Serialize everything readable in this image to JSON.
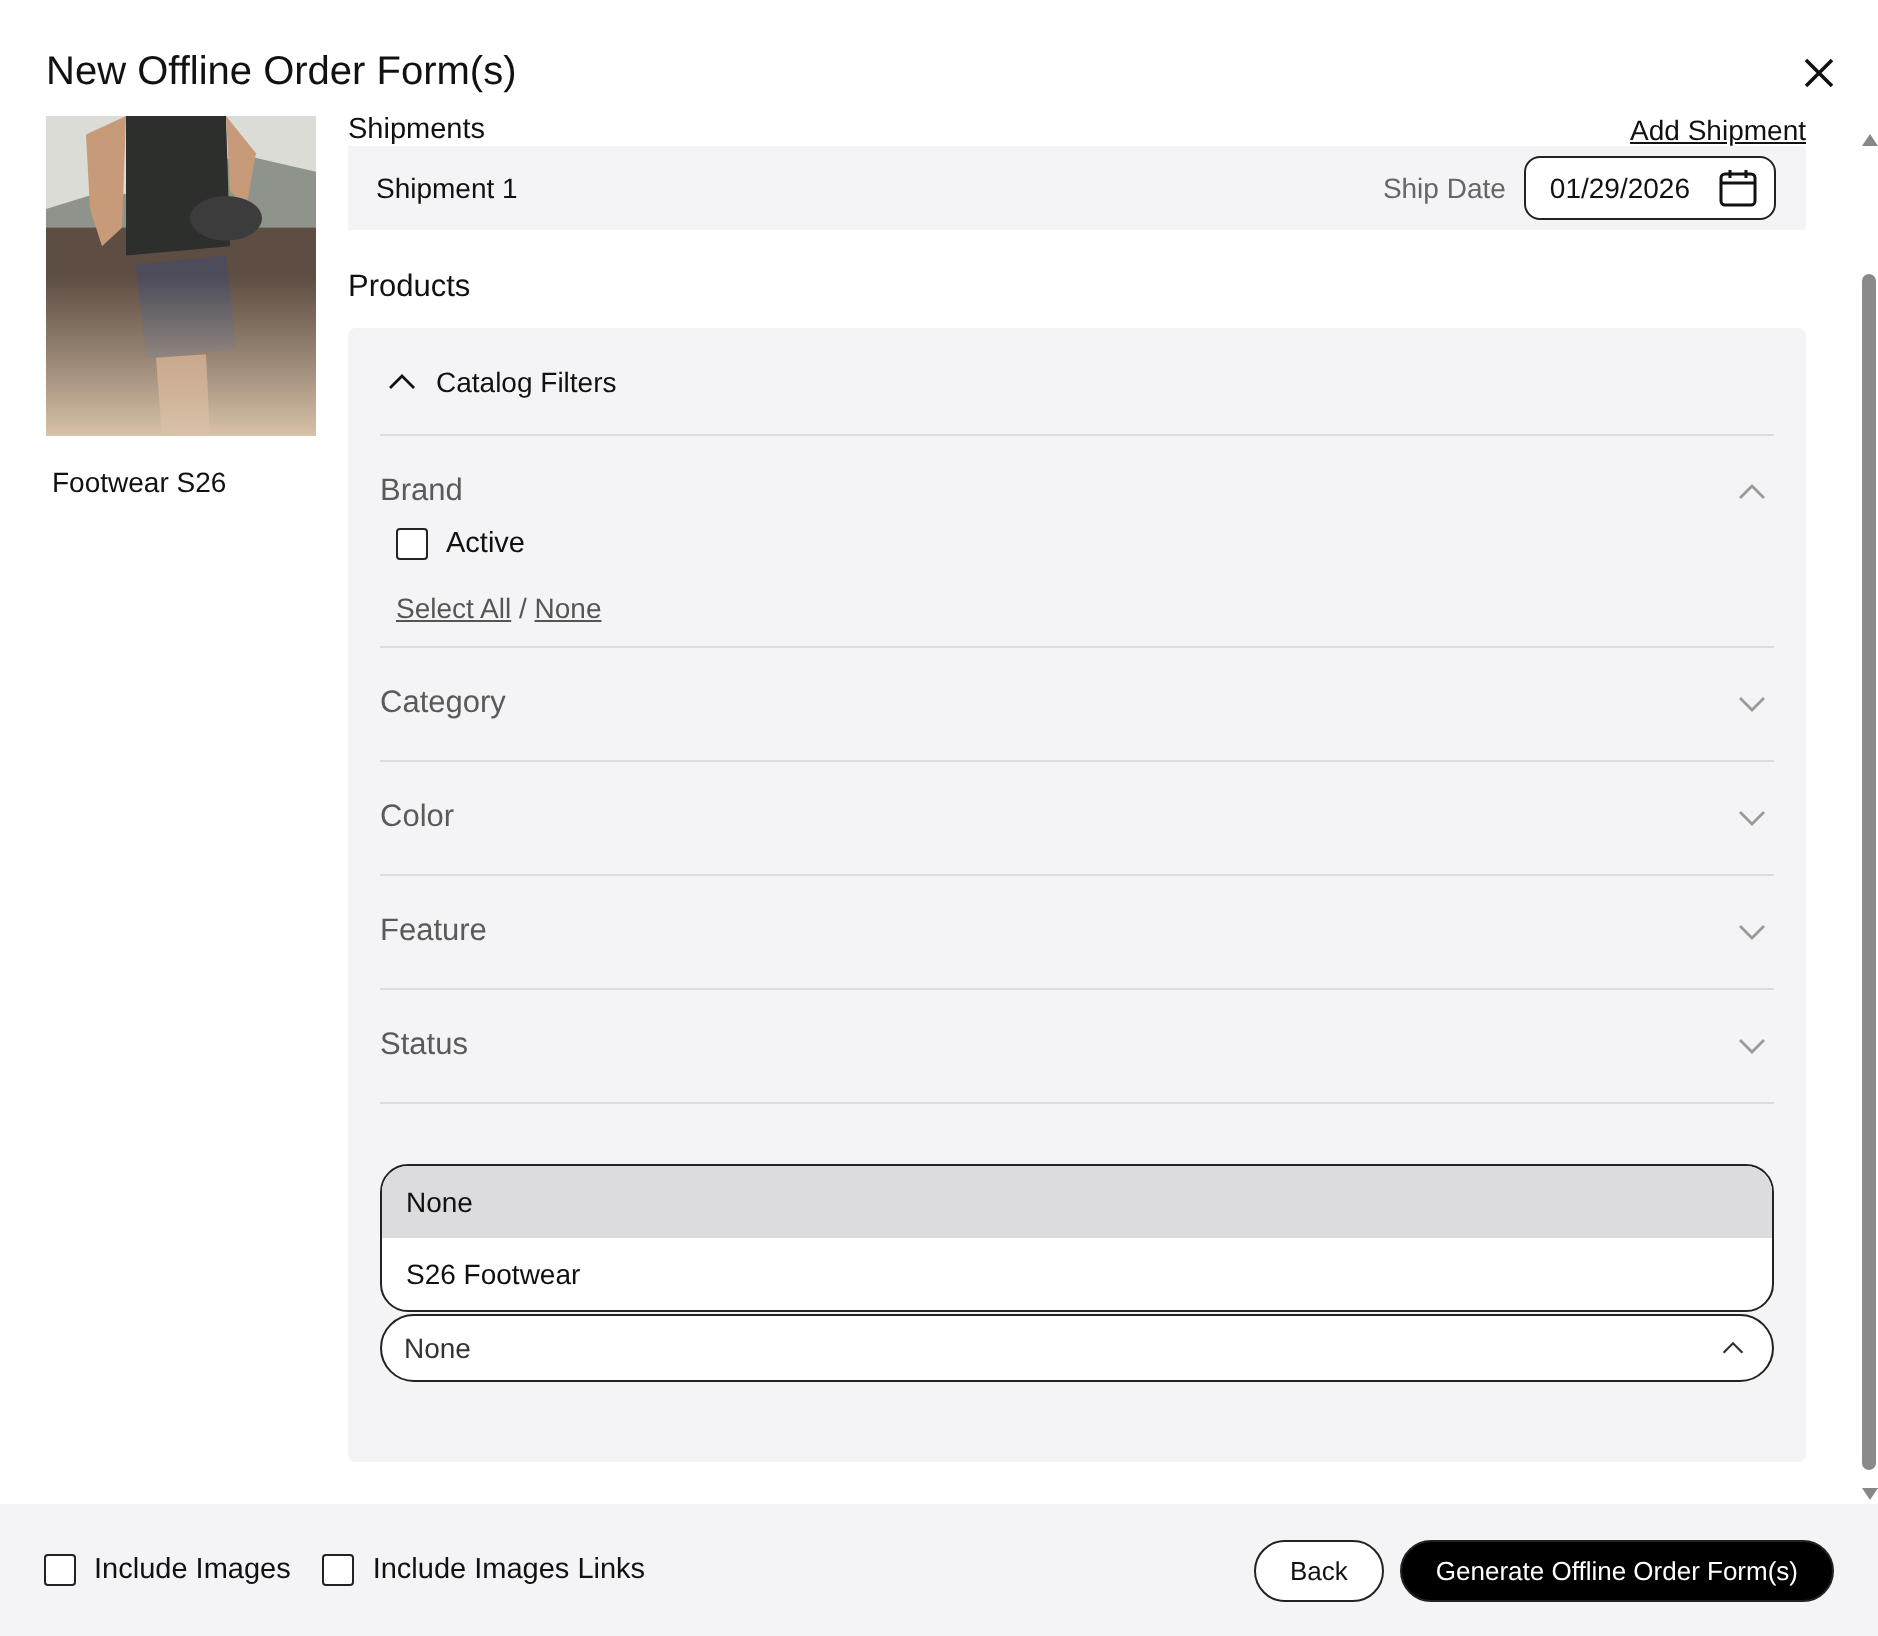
{
  "dialog": {
    "title": "New Offline Order Form(s)"
  },
  "catalog": {
    "name": "Footwear S26"
  },
  "shipments": {
    "heading": "Shipments",
    "add_link": "Add Shipment",
    "items": [
      {
        "name": "Shipment 1",
        "date_label": "Ship Date",
        "date": "01/29/2026"
      }
    ]
  },
  "products": {
    "heading": "Products",
    "filters": {
      "title": "Catalog Filters",
      "expanded": true,
      "sections": [
        {
          "label": "Brand",
          "expanded": true,
          "options": [
            {
              "label": "Active",
              "checked": false
            }
          ],
          "select_all": "Select All",
          "separator": "/",
          "select_none": "None"
        },
        {
          "label": "Category",
          "expanded": false
        },
        {
          "label": "Color",
          "expanded": false
        },
        {
          "label": "Feature",
          "expanded": false
        },
        {
          "label": "Status",
          "expanded": false
        }
      ],
      "dropdown": {
        "value": "None",
        "open": true,
        "options": [
          {
            "label": "None",
            "selected": true
          },
          {
            "label": "S26 Footwear",
            "selected": false
          }
        ]
      }
    }
  },
  "footer": {
    "options": [
      {
        "label": "Include Images",
        "checked": false
      },
      {
        "label": "Include Images Links",
        "checked": false
      }
    ],
    "buttons": [
      {
        "label": "Back",
        "kind": "secondary"
      },
      {
        "label": "Generate Offline Order Form(s)",
        "kind": "primary"
      }
    ]
  }
}
